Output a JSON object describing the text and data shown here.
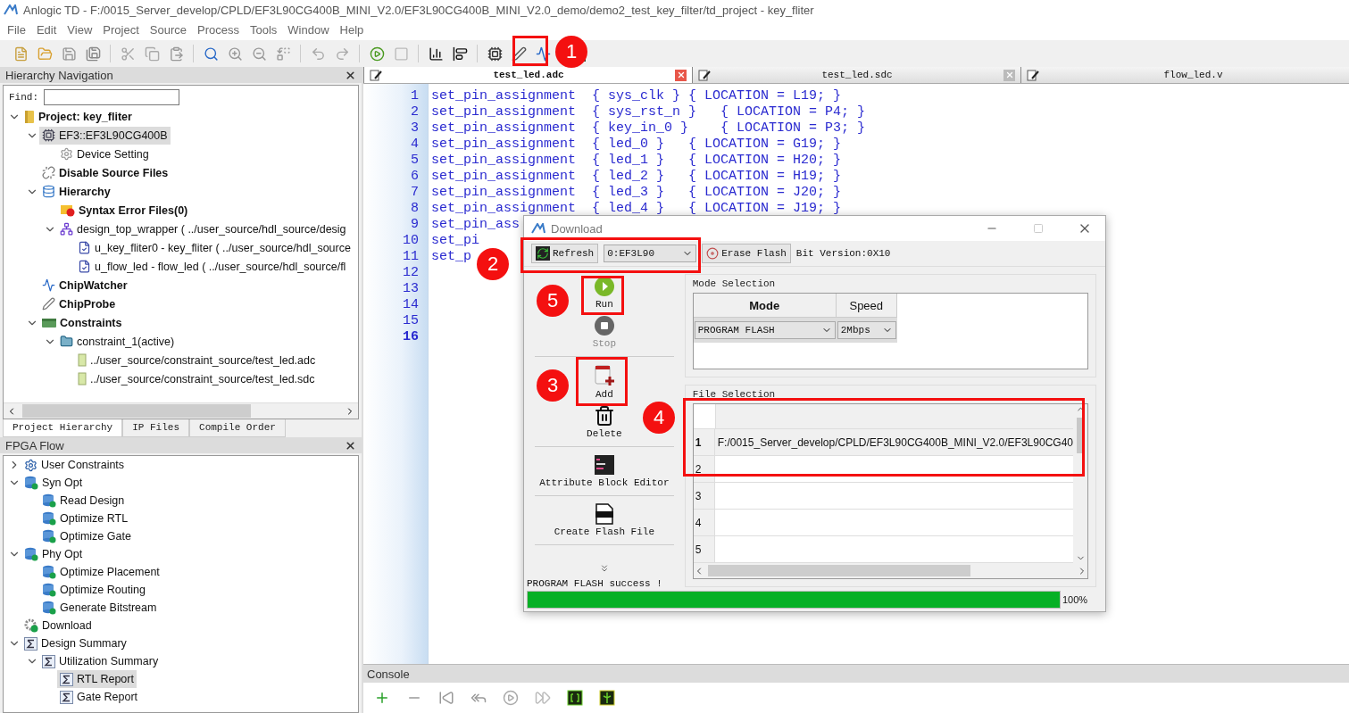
{
  "window": {
    "title": "Anlogic TD - F:/0015_Server_develop/CPLD/EF3L90CG400B_MINI_V2.0/EF3L90CG400B_MINI_V2.0_demo/demo2_test_key_filter/td_project - key_fliter"
  },
  "menu": [
    "File",
    "Edit",
    "View",
    "Project",
    "Source",
    "Process",
    "Tools",
    "Window",
    "Help"
  ],
  "hierarchy_panel": {
    "title": "Hierarchy Navigation",
    "find_label": "Find:",
    "tree": [
      {
        "label": "Project: key_fliter",
        "kind": "project",
        "bold": true,
        "selected": false,
        "expanded": true,
        "children": [
          {
            "label": "EF3::EF3L90CG400B",
            "kind": "chip",
            "bold": false,
            "selected": true,
            "expanded": true,
            "children": [
              {
                "label": "Device Setting",
                "kind": "gear",
                "bold": false,
                "selected": false
              }
            ]
          },
          {
            "label": "Disable Source Files",
            "kind": "unlink",
            "bold": true,
            "selected": false
          },
          {
            "label": "Hierarchy",
            "kind": "database",
            "bold": true,
            "selected": false,
            "expanded": true,
            "children": [
              {
                "label": "Syntax Error Files(0)",
                "kind": "error-folder",
                "bold": true,
                "selected": false
              },
              {
                "label": "design_top_wrapper ( ../user_source/hdl_source/desig",
                "kind": "hierarchy",
                "bold": false,
                "selected": false,
                "expanded": true,
                "children": [
                  {
                    "label": "u_key_fliter0 - key_fliter ( ../user_source/hdl_source",
                    "kind": "verilog",
                    "bold": false,
                    "selected": false
                  },
                  {
                    "label": "u_flow_led - flow_led ( ../user_source/hdl_source/fl",
                    "kind": "verilog",
                    "bold": false,
                    "selected": false
                  }
                ]
              }
            ]
          },
          {
            "label": "ChipWatcher",
            "kind": "wave",
            "bold": true,
            "selected": false
          },
          {
            "label": "ChipProbe",
            "kind": "probe",
            "bold": true,
            "selected": false
          },
          {
            "label": "Constraints",
            "kind": "constraints",
            "bold": true,
            "selected": false,
            "expanded": true,
            "children": [
              {
                "label": "constraint_1(active)",
                "kind": "folder",
                "bold": false,
                "selected": false,
                "expanded": true,
                "children": [
                  {
                    "label": "../user_source/constraint_source/test_led.adc",
                    "kind": "file",
                    "bold": false,
                    "selected": false
                  },
                  {
                    "label": "../user_source/constraint_source/test_led.sdc",
                    "kind": "file",
                    "bold": false,
                    "selected": false
                  }
                ]
              }
            ]
          }
        ]
      }
    ],
    "tabs": [
      {
        "label": "Project Hierarchy",
        "selected": true
      },
      {
        "label": "IP Files",
        "selected": false
      },
      {
        "label": "Compile Order",
        "selected": false
      }
    ]
  },
  "flow_panel": {
    "title": "FPGA Flow",
    "tree": [
      {
        "label": "User Constraints",
        "kind": "gear-blue",
        "bold": false,
        "selected": false,
        "expanded": false
      },
      {
        "label": "Syn Opt",
        "kind": "flow-db",
        "bold": false,
        "selected": false,
        "expanded": true,
        "children": [
          {
            "label": "Read Design",
            "kind": "flow-db",
            "bold": false,
            "selected": false
          },
          {
            "label": "Optimize RTL",
            "kind": "flow-db",
            "bold": false,
            "selected": false
          },
          {
            "label": "Optimize Gate",
            "kind": "flow-db",
            "bold": false,
            "selected": false
          }
        ]
      },
      {
        "label": "Phy Opt",
        "kind": "flow-db",
        "bold": false,
        "selected": false,
        "expanded": true,
        "children": [
          {
            "label": "Optimize Placement",
            "kind": "flow-db",
            "bold": false,
            "selected": false
          },
          {
            "label": "Optimize Routing",
            "kind": "flow-db",
            "bold": false,
            "selected": false
          },
          {
            "label": "Generate Bitstream",
            "kind": "flow-db",
            "bold": false,
            "selected": false
          }
        ]
      },
      {
        "label": "Download",
        "kind": "download",
        "bold": false,
        "selected": false
      },
      {
        "label": "Design Summary",
        "kind": "sigma",
        "bold": false,
        "selected": false,
        "expanded": true,
        "children": [
          {
            "label": "Utilization Summary",
            "kind": "sigma",
            "bold": false,
            "selected": false,
            "expanded": true,
            "children": [
              {
                "label": "RTL Report",
                "kind": "sigma",
                "bold": false,
                "selected": true
              },
              {
                "label": "Gate Report",
                "kind": "sigma",
                "bold": false,
                "selected": false
              }
            ]
          }
        ]
      }
    ]
  },
  "editor": {
    "tabs": [
      {
        "label": "test_led.adc",
        "selected": true,
        "closable": true
      },
      {
        "label": "test_led.sdc",
        "selected": false,
        "closable": true
      },
      {
        "label": "flow_led.v",
        "selected": false,
        "closable": false
      }
    ],
    "lines": [
      {
        "number": "1",
        "code": "set_pin_assignment  { sys_clk } { LOCATION = L19; }",
        "current": false
      },
      {
        "number": "2",
        "code": "set_pin_assignment  { sys_rst_n }   { LOCATION = P4; }",
        "current": false
      },
      {
        "number": "3",
        "code": "set_pin_assignment  { key_in_0 }    { LOCATION = P3; }",
        "current": false
      },
      {
        "number": "4",
        "code": "set_pin_assignment  { led_0 }   { LOCATION = G19; }",
        "current": false
      },
      {
        "number": "5",
        "code": "set_pin_assignment  { led_1 }   { LOCATION = H20; }",
        "current": false
      },
      {
        "number": "6",
        "code": "set_pin_assignment  { led_2 }   { LOCATION = H19; }",
        "current": false
      },
      {
        "number": "7",
        "code": "set_pin_assignment  { led_3 }   { LOCATION = J20; }",
        "current": false
      },
      {
        "number": "8",
        "code": "set_pin_assignment  { led_4 }   { LOCATION = J19; }",
        "current": false
      },
      {
        "number": "9",
        "code": "set_pin_ass",
        "current": false
      },
      {
        "number": "10",
        "code": "set_pi",
        "current": false
      },
      {
        "number": "11",
        "code": "set_p",
        "current": false
      },
      {
        "number": "12",
        "current": false
      },
      {
        "number": "13",
        "current": false
      },
      {
        "number": "14",
        "current": false
      },
      {
        "number": "15",
        "current": false
      },
      {
        "number": "16",
        "current": true
      }
    ]
  },
  "console": {
    "title": "Console"
  },
  "download_dialog": {
    "title": "Download",
    "toolbar": {
      "refresh": "Refresh",
      "device": "0:EF3L90",
      "erase": "Erase Flash",
      "bit_version": "Bit Version:0X10"
    },
    "actions": [
      {
        "label": "Run",
        "kind": "run",
        "disabled": false
      },
      {
        "label": "Stop",
        "kind": "stop",
        "disabled": true
      },
      {
        "label": "Add",
        "kind": "add",
        "disabled": false
      },
      {
        "label": "Delete",
        "kind": "delete",
        "disabled": false
      },
      {
        "label": "Attribute Block Editor",
        "kind": "attribute",
        "disabled": false
      },
      {
        "label": "Create Flash File",
        "kind": "flash",
        "disabled": false
      }
    ],
    "mode_group": {
      "title": "Mode Selection",
      "columns": [
        "Mode",
        "Speed"
      ],
      "mode": "PROGRAM FLASH",
      "speed": "2Mbps"
    },
    "file_group": {
      "title": "File Selection",
      "rows": [
        {
          "number": "1",
          "path": "F:/0015_Server_develop/CPLD/EF3L90CG400B_MINI_V2.0/EF3L90CG40"
        },
        {
          "number": "2"
        },
        {
          "number": "3"
        },
        {
          "number": "4"
        },
        {
          "number": "5"
        }
      ]
    },
    "status": "PROGRAM FLASH success !",
    "progress": {
      "level": 1,
      "reading": "100%"
    }
  },
  "markers": [
    {
      "label": "1"
    },
    {
      "label": "2"
    },
    {
      "label": "5"
    },
    {
      "label": "3"
    },
    {
      "label": "4"
    }
  ]
}
